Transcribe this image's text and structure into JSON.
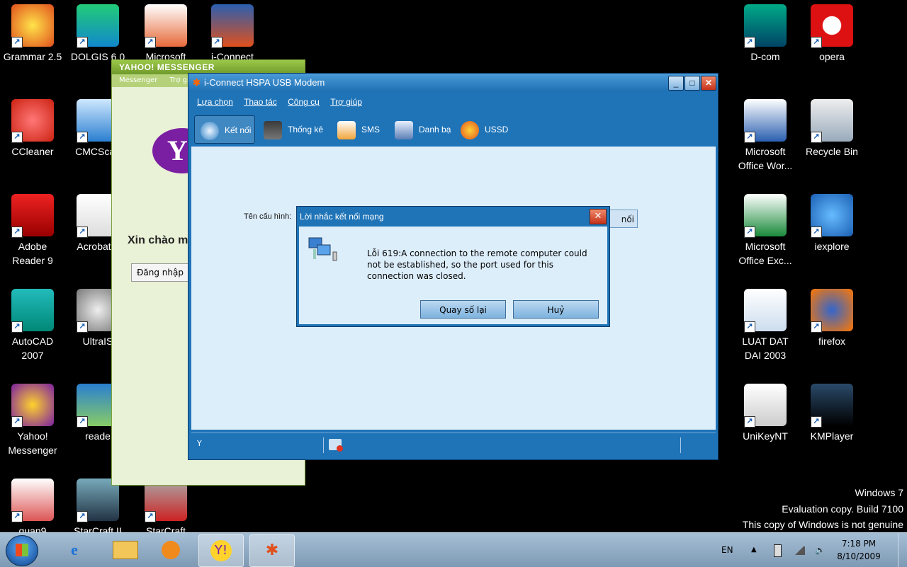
{
  "desktop_left": [
    {
      "label": "Grammar 2.5",
      "icon": "sun-star-icon"
    },
    {
      "label": "DOLGIS 6.0",
      "icon": "dg-icon"
    },
    {
      "label": "Microsoft",
      "icon": "powerpoint-icon"
    },
    {
      "label": "i-Connect",
      "icon": "iconnect-icon"
    },
    {
      "label": "CCleaner",
      "icon": "ccleaner-icon"
    },
    {
      "label": "CMCScan",
      "icon": "cmc-shield-icon"
    },
    {
      "label": "Adobe\nReader 9",
      "icon": "adobe-reader-icon"
    },
    {
      "label": "Acrobat.c",
      "icon": "acrobat-icon"
    },
    {
      "label": "AutoCAD\n2007",
      "icon": "autocad-icon"
    },
    {
      "label": "UltraIS",
      "icon": "ultraiso-icon"
    },
    {
      "label": "Yahoo!\nMessenger",
      "icon": "yahoo-icon"
    },
    {
      "label": "reade",
      "icon": "reader-globe-icon"
    },
    {
      "label": "quan9",
      "icon": "map-icon"
    },
    {
      "label": "StarCraft II",
      "icon": "starcraft-icon"
    },
    {
      "label": "StarCraft",
      "icon": "starcraft-ship-icon"
    }
  ],
  "desktop_right": [
    {
      "label": "D-com",
      "icon": "dcom-icon"
    },
    {
      "label": "opera",
      "icon": "opera-icon"
    },
    {
      "label": "Microsoft\nOffice Wor...",
      "icon": "word-icon"
    },
    {
      "label": "Recycle Bin",
      "icon": "recycle-bin-icon"
    },
    {
      "label": "Microsoft\nOffice Exc...",
      "icon": "excel-icon"
    },
    {
      "label": "iexplore",
      "icon": "ie-icon"
    },
    {
      "label": "LUAT DAT\nDAI 2003",
      "icon": "word-doc-icon"
    },
    {
      "label": "firefox",
      "icon": "firefox-icon"
    },
    {
      "label": "UniKeyNT",
      "icon": "unikey-icon"
    },
    {
      "label": "KMPlayer",
      "icon": "kmplayer-icon"
    }
  ],
  "yahoo": {
    "title": "YAHOO! MESSENGER",
    "menu": [
      "Messenger",
      "Trợ giú"
    ],
    "greeting": "Xin chào m",
    "login": "Đăng nhập"
  },
  "modem": {
    "title": "i-Connect HSPA USB Modem",
    "menu": [
      "Lựa chọn",
      "Thao tác",
      "Công cụ",
      "Trợ giúp"
    ],
    "toolbar": [
      "Kết nối",
      "Thống kê",
      "SMS",
      "Danh bạ",
      "USSD"
    ],
    "config_label": "Tên cấu hình:",
    "config_button": "nối",
    "status_signal": "Y"
  },
  "dialog": {
    "title": "Lời nhắc kết nối mạng",
    "message": "Lỗi 619:A connection to the remote computer could not be established, so the port used for this connection was closed.",
    "redial": "Quay số lại",
    "cancel": "Huỷ"
  },
  "watermark": [
    "Windows 7",
    "Evaluation copy. Build 7100",
    "This copy of Windows is not genuine"
  ],
  "taskbar": {
    "lang": "EN",
    "time": "7:18 PM",
    "date": "8/10/2009"
  },
  "colors": {
    "window_blue": "#1f74b8",
    "content_blue": "#ddeefb",
    "yahoo_purple": "#7b1fa2",
    "yahoo_green": "#e9f1d6"
  }
}
